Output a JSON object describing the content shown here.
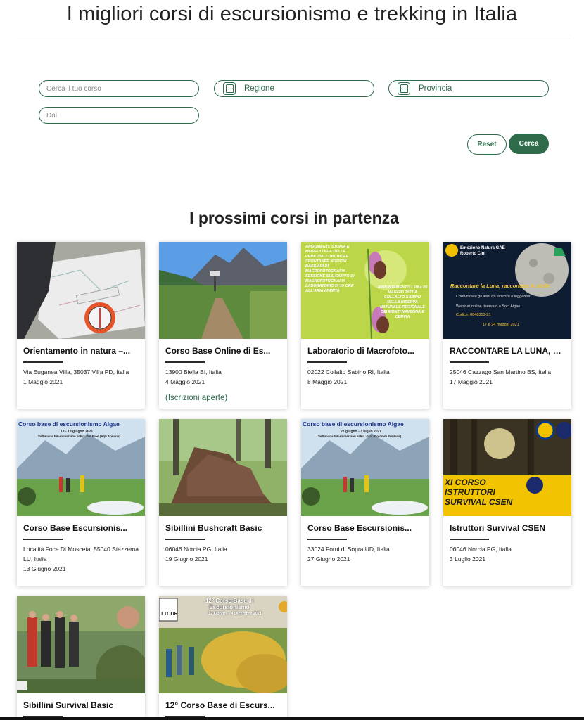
{
  "header": {
    "title": "I migliori corsi di escursionismo e trekking in Italia"
  },
  "search": {
    "course_placeholder": "Cerca il tuo corso",
    "region_label": "Regione",
    "province_label": "Provincia",
    "date_placeholder": "Dal",
    "reset_label": "Reset",
    "search_label": "Cerca"
  },
  "upcoming": {
    "title": "I prossimi corsi in partenza",
    "cards": [
      {
        "title": "Orientamento in natura –...",
        "address": "Via Euganea Villa, 35037 Villa PD, Italia",
        "date": "1 Maggio 2021",
        "status": "",
        "image": "compass-map-photo"
      },
      {
        "title": "Corso Base Online di Es...",
        "address": "13900 Biella BI, Italia",
        "date": "4 Maggio 2021",
        "status": "(Iscrizioni aperte)",
        "image": "mountain-trail-photo"
      },
      {
        "title": "Laboratorio di Macrofoto...",
        "address": "02022 Collalto Sabino RI, Italia",
        "date": "8 Maggio 2021",
        "status": "",
        "image": "orchid-flyer"
      },
      {
        "title": "RACCONTARE LA LUNA, R...",
        "address": "25046 Cazzago San Martino BS, Italia",
        "date": "17 Maggio 2021",
        "status": "",
        "image": "moon-flyer"
      },
      {
        "title": "Corso Base Escursionis...",
        "address": "Località Foce Di Mosceta, 55040 Stazzema LU, Italia",
        "date": "13 Giugno 2021",
        "status": "",
        "image": "hikers-poster"
      },
      {
        "title": "Sibillini Bushcraft Basic",
        "address": "06046 Norcia PG, Italia",
        "date": "19 Giugno 2021",
        "status": "",
        "image": "forest-shelter-photo"
      },
      {
        "title": "Corso Base Escursionis...",
        "address": "33024 Forni di Sopra UD, Italia",
        "date": "27 Giugno 2021",
        "status": "",
        "image": "hikers-poster"
      },
      {
        "title": "Istruttori Survival CSEN",
        "address": "06046 Norcia PG, Italia",
        "date": "3 Luglio 2021",
        "status": "",
        "image": "survival-poster"
      },
      {
        "title": "Sibillini Survival Basic",
        "address": "",
        "date": "",
        "status": "",
        "image": "group-photo"
      },
      {
        "title": "12° Corso Base di Escurs...",
        "address": "",
        "date": "",
        "status": "",
        "image": "autumn-hike-poster"
      }
    ]
  },
  "overlays": {
    "orchid_text": "ARGOMENTI: STORIA E MORFOLOGIA DELLE PRINCIPALI ORCHIDEE SPONTANEE NOZIONI BASILARI DI MACROFOTOGRAFIA SESSIONE SUL CAMPO DI MACROFOTOGRAFIA LABORATORIO DI 10 ORE ALL'ARIA APERTA",
    "orchid_date": "APPUNTAMENTO L'08 e 09 MAGGIO 2021 A COLLALTO SABINO NELLA RISERVA NATURALE REGIONALE DEI MONTI NAVEGNA E CERVIA",
    "moon_org": "Emozione Natura GAE Roberto Cini",
    "moon_headline": "Raccontare la Luna, raccontare le stelle",
    "moon_sub": "Comunicare gli astri tra scienza e leggenda",
    "moon_webinar": "Webinar online riservato a Soci Aigae",
    "moon_code": "Codice: 0848353-21",
    "moon_dates": "17 e 24 maggio 2021",
    "hikers1_title": "Corso base di escursionismo Aigae",
    "hikers1_dates": "13 - 19 giugno 2021",
    "hikers1_place": "Settimana full-immersion al Rif. Del Freo (Alpi Apuane)",
    "hikers2_title": "Corso base di escursionismo Aigae",
    "hikers2_dates": "27 giugno - 3 luglio 2021",
    "hikers2_place": "Settimana full-immersion al Rif. Giaf (Dolomiti Friulane)",
    "survival_line1": "XI CORSO",
    "survival_line2": "ISTRUTTORI",
    "survival_line3": "SURVIVAL CSEN",
    "autumn_badge": "LTOUR",
    "autumn_title": "12° Corso Base di Escursionismo",
    "autumn_dates": "12 Ottobre - 4 Dicembre 2021"
  },
  "colors": {
    "accent": "#2e6b4a",
    "text": "#1d1d1d"
  }
}
